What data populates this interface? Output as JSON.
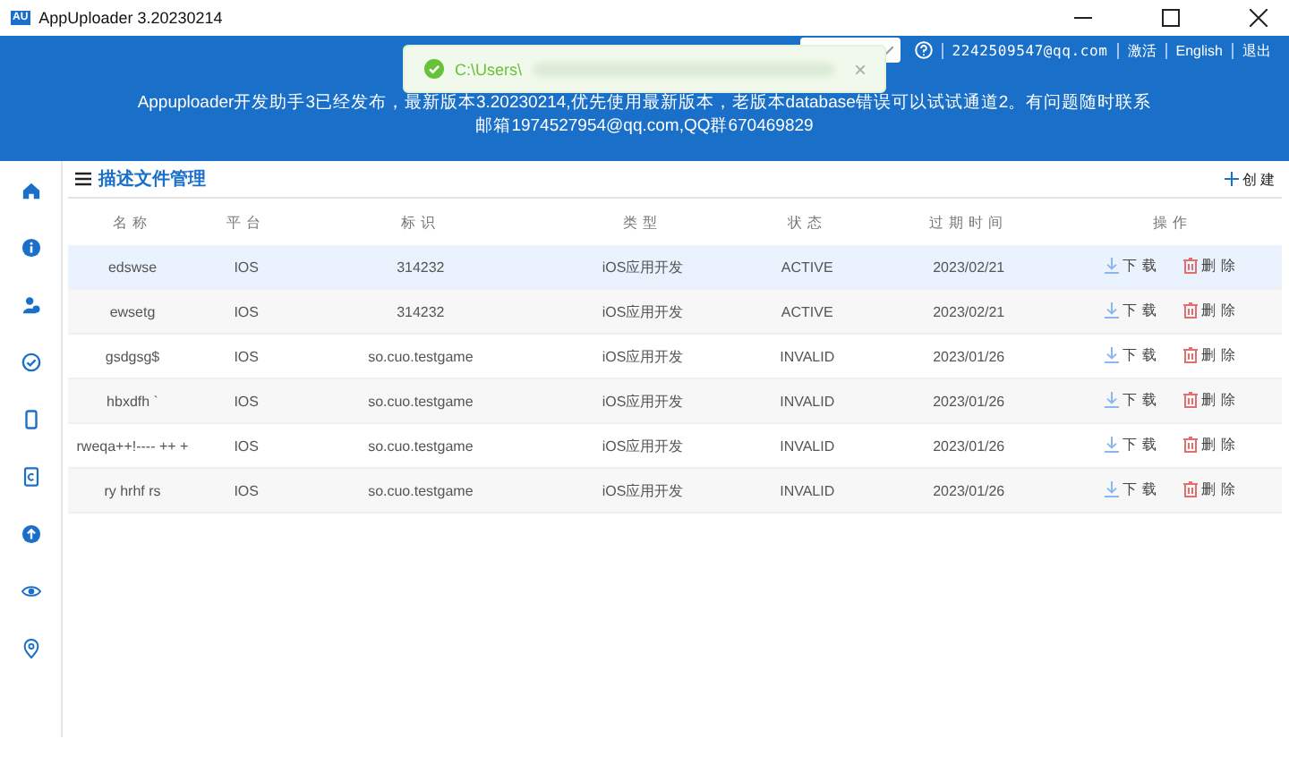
{
  "window": {
    "title": "AppUploader 3.20230214",
    "logo": "AU"
  },
  "header": {
    "email": "2242509547@qq.com",
    "links": [
      {
        "label": "激活"
      },
      {
        "label": "English"
      },
      {
        "label": "退出"
      }
    ],
    "notice": [
      "Appuploader开发助手3已经发布，最新版本3.20230214,优先使用最新版本，老版本database错误可以试试通道2。有问题随时联系",
      "邮箱1974527954@qq.com,QQ群670469829"
    ]
  },
  "toast": {
    "text": "C:\\Users\\",
    "close": "×"
  },
  "page": {
    "title": "描述文件管理",
    "create": "创建"
  },
  "table": {
    "columns": [
      "名称",
      "平台",
      "标识",
      "类型",
      "状态",
      "过期时间",
      "操作"
    ],
    "rows": [
      {
        "name": "edswse",
        "platform": "IOS",
        "id": "314232",
        "type": "iOS应用开发",
        "status": "ACTIVE",
        "expires": "2023/02/21",
        "download": "下载",
        "delete": "删除",
        "selected": true
      },
      {
        "name": "ewsetg",
        "platform": "IOS",
        "id": "314232",
        "type": "iOS应用开发",
        "status": "ACTIVE",
        "expires": "2023/02/21",
        "download": "下载",
        "delete": "删除",
        "selected": false
      },
      {
        "name": "gsdgsg$",
        "platform": "IOS",
        "id": "so.cuo.testgame",
        "type": "iOS应用开发",
        "status": "INVALID",
        "expires": "2023/01/26",
        "download": "下载",
        "delete": "删除",
        "selected": false
      },
      {
        "name": "hbxdfh  `",
        "platform": "IOS",
        "id": "so.cuo.testgame",
        "type": "iOS应用开发",
        "status": "INVALID",
        "expires": "2023/01/26",
        "download": "下载",
        "delete": "删除",
        "selected": false
      },
      {
        "name": "rweqa++!---- ++ +",
        "platform": "IOS",
        "id": "so.cuo.testgame",
        "type": "iOS应用开发",
        "status": "INVALID",
        "expires": "2023/01/26",
        "download": "下载",
        "delete": "删除",
        "selected": false
      },
      {
        "name": "ry hrhf rs",
        "platform": "IOS",
        "id": "so.cuo.testgame",
        "type": "iOS应用开发",
        "status": "INVALID",
        "expires": "2023/01/26",
        "download": "下载",
        "delete": "删除",
        "selected": false
      }
    ]
  }
}
